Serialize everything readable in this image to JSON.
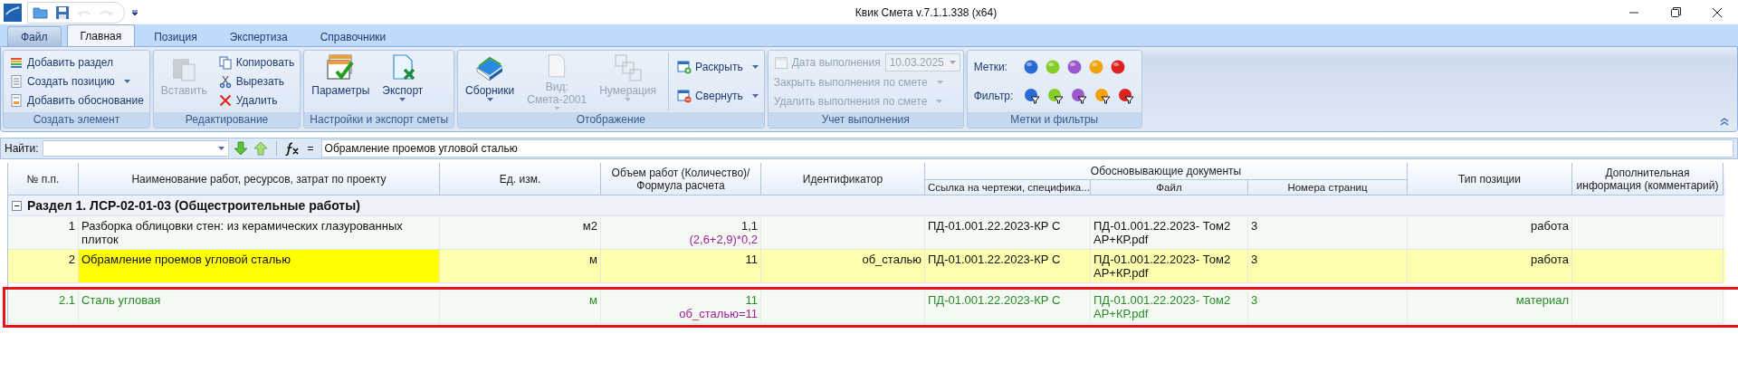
{
  "window": {
    "title": "Квик Смета v.7.1.1.338 (x64)"
  },
  "quick_access": [
    {
      "kind": "open",
      "disabled": false
    },
    {
      "kind": "save",
      "disabled": false
    },
    {
      "kind": "undo",
      "disabled": true
    },
    {
      "kind": "redo",
      "disabled": true
    }
  ],
  "tabs": [
    {
      "label": "Файл",
      "kind": "file",
      "selected": false
    },
    {
      "label": "Главная",
      "kind": "tab",
      "selected": true
    },
    {
      "label": "Позиция",
      "kind": "tab",
      "selected": false
    },
    {
      "label": "Экспертиза",
      "kind": "tab",
      "selected": false
    },
    {
      "label": "Справочники",
      "kind": "tab",
      "selected": false
    }
  ],
  "ribbon": {
    "groups": [
      {
        "caption": "Создать элемент",
        "items": [
          {
            "kind": "small",
            "label": "Добавить раздел",
            "disabled": false,
            "dropdown": false
          },
          {
            "kind": "small",
            "label": "Создать позицию",
            "disabled": false,
            "dropdown": true
          },
          {
            "kind": "small",
            "label": "Добавить обоснование",
            "disabled": false,
            "dropdown": false
          }
        ]
      },
      {
        "caption": "Редактирование",
        "items": [
          {
            "kind": "large",
            "label": "Вставить",
            "disabled": true,
            "dropdown": false
          },
          {
            "kind": "small",
            "label": "Копировать",
            "disabled": false,
            "dropdown": false
          },
          {
            "kind": "small",
            "label": "Вырезать",
            "disabled": false,
            "dropdown": false
          },
          {
            "kind": "small",
            "label": "Удалить",
            "disabled": false,
            "dropdown": false
          }
        ]
      },
      {
        "caption": "Настройки и экспорт сметы",
        "items": [
          {
            "kind": "large",
            "label": "Параметры",
            "disabled": false,
            "dropdown": false
          },
          {
            "kind": "large",
            "label": "Экспорт",
            "disabled": false,
            "dropdown": true
          }
        ]
      },
      {
        "caption": "Отображение",
        "items": [
          {
            "kind": "large",
            "label": "Сборники",
            "disabled": false,
            "dropdown": true
          },
          {
            "kind": "large",
            "label": "Вид:",
            "sublabel": "Смета-2001",
            "disabled": true,
            "dropdown": true
          },
          {
            "kind": "large",
            "label": "Нумерация",
            "disabled": true,
            "dropdown": true
          },
          {
            "kind": "small",
            "label": "Раскрыть",
            "disabled": false,
            "dropdown": true
          },
          {
            "kind": "small",
            "label": "Свернуть",
            "disabled": false,
            "dropdown": true
          }
        ]
      },
      {
        "caption": "Учет выполнения",
        "items": [
          {
            "kind": "date",
            "label": "Дата выполнения",
            "value": "10.03.2025",
            "disabled": true,
            "dropdown": true
          },
          {
            "kind": "small",
            "label": "Закрыть выполнения по смете",
            "disabled": true,
            "dropdown": true
          },
          {
            "kind": "small",
            "label": "Удалить выполнения по смете",
            "disabled": true,
            "dropdown": true
          }
        ]
      },
      {
        "caption": "Метки и фильтры",
        "items": [
          {
            "kind": "marks",
            "label": "Метки:",
            "dots": [
              {
                "color": "#2a6ad8"
              },
              {
                "color": "#86cc2a"
              },
              {
                "color": "#9c58cf"
              },
              {
                "color": "#f4a20c"
              },
              {
                "color": "#dd2222"
              }
            ]
          },
          {
            "kind": "filters",
            "label": "Фильтр:",
            "dots": [
              {
                "color": "#2a6ad8"
              },
              {
                "color": "#86cc2a"
              },
              {
                "color": "#9c58cf"
              },
              {
                "color": "#f4a20c"
              },
              {
                "color": "#dd2222"
              }
            ]
          }
        ]
      }
    ]
  },
  "find_bar": {
    "label": "Найти:",
    "formula_sign": "=",
    "formula": "Обрамление проемов угловой сталью"
  },
  "table": {
    "columns": [
      {
        "label": "№ п.п."
      },
      {
        "label": "Наименование работ, ресурсов, затрат по проекту"
      },
      {
        "label": "Ед. изм."
      },
      {
        "label": "Объем работ (Количество)/ Формула расчета"
      },
      {
        "label": "Идентификатор"
      },
      {
        "label": "Обосновывающие  документы",
        "children": [
          {
            "label": "Ссылка на чертежи, специфика..."
          },
          {
            "label": "Файл"
          },
          {
            "label": "Номера страниц"
          }
        ]
      },
      {
        "label": "Тип позиции"
      },
      {
        "label": "Дополнительная информация (комментарий)"
      }
    ],
    "section": {
      "title": "Раздел 1. ЛСР-02-01-03 (Общестроительные работы)",
      "expanded": true
    },
    "rows": [
      {
        "kind": "work",
        "selected": false,
        "highlighted": false,
        "number": "1",
        "name": "Разборка облицовки стен: из керамических глазурованных плиток",
        "unit": "м2",
        "volume": "1,1",
        "formula": "(2,6+2,9)*0,2",
        "link": "ПД-01.001.22.2023-КР С",
        "file": "ПД-01.001.22.2023- Том2 АР+КР.pdf",
        "pages": "3",
        "type": "работа"
      },
      {
        "kind": "work",
        "selected": true,
        "highlighted": false,
        "number": "2",
        "name": "Обрамление проемов угловой сталью",
        "unit": "м",
        "volume": "11",
        "identifier": "об_сталью",
        "link": "ПД-01.001.22.2023-КР С",
        "file": "ПД-01.001.22.2023- Том2 АР+КР.pdf",
        "pages": "3",
        "type": "работа"
      },
      {
        "kind": "material",
        "selected": false,
        "highlighted": true,
        "number": "2.1",
        "name": "Сталь угловая",
        "unit": "м",
        "volume": "11",
        "formula": "об_сталью=11",
        "link": "ПД-01.001.22.2023-КР С",
        "file": "ПД-01.001.22.2023- Том2 АР+КР.pdf",
        "pages": "3",
        "type": "материал"
      }
    ]
  }
}
